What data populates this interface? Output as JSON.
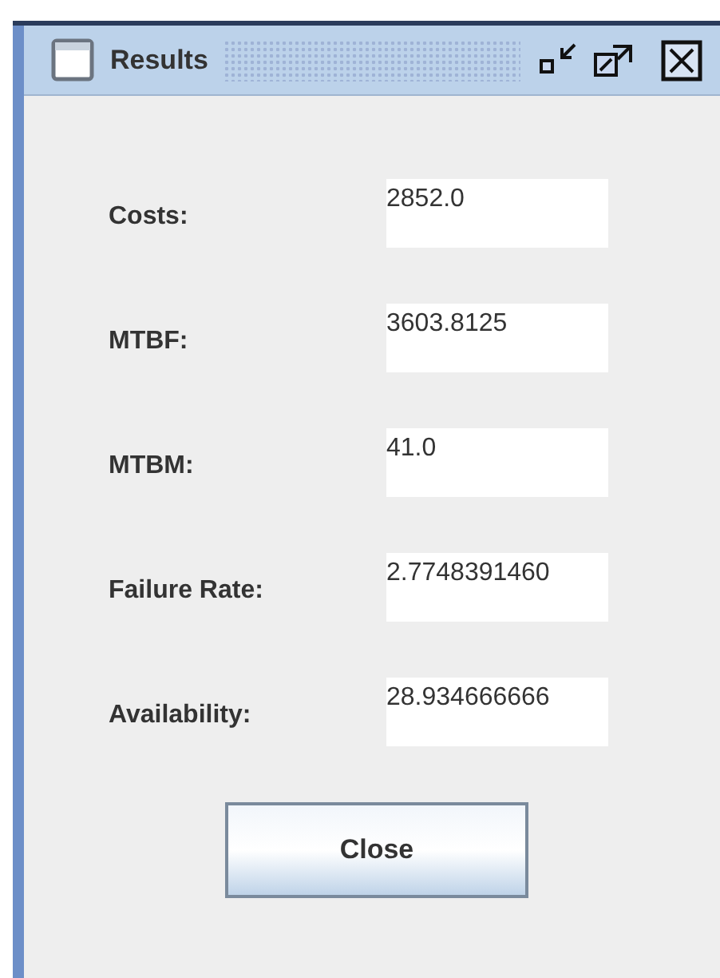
{
  "window": {
    "title": "Results"
  },
  "fields": [
    {
      "label": "Costs:",
      "value": "2852.0"
    },
    {
      "label": "MTBF:",
      "value": "3603.8125"
    },
    {
      "label": "MTBM:",
      "value": "41.0"
    },
    {
      "label": "Failure Rate:",
      "value": "2.7748391460"
    },
    {
      "label": "Availability:",
      "value": "28.934666666"
    }
  ],
  "buttons": [
    "Close"
  ]
}
